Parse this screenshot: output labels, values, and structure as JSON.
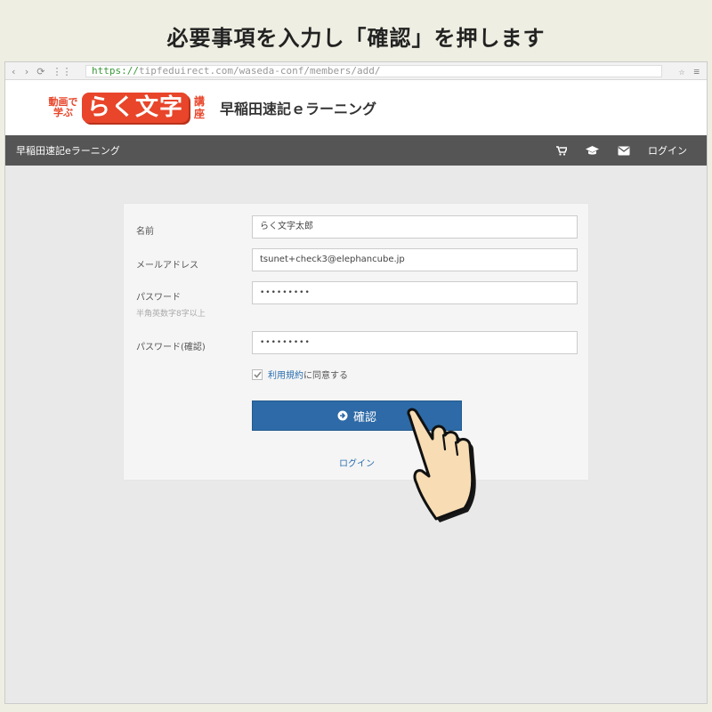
{
  "instruction": "必要事項を入力し「確認」を押します",
  "browser": {
    "url_scheme": "https://",
    "url_rest": "tipfeduirect.com/waseda-conf/members/add/",
    "nav_back": "‹",
    "nav_forward": "›",
    "nav_reload": "⟳",
    "nav_apps": "⋮⋮",
    "star": "☆",
    "menu": "≡"
  },
  "logo": {
    "small_line1": "動画で",
    "small_line2": "学ぶ",
    "big": "らく文字",
    "kou_line1": "講",
    "kou_line2": "座"
  },
  "site_name": "早稲田速記ｅラーニング",
  "navbar": {
    "brand": "早稲田速記eラーニング",
    "login": "ログイン",
    "icons": [
      "cart-icon",
      "graduation-cap-icon",
      "envelope-icon"
    ]
  },
  "form": {
    "name_label": "名前",
    "name_value": "らく文字太郎",
    "email_label": "メールアドレス",
    "email_value": "tsunet+check3@elephancube.jp",
    "password_label": "パスワード",
    "password_hint": "半角英数字8字以上",
    "password_value": "•••••••••",
    "password_confirm_label": "パスワード(確認)",
    "password_confirm_value": "•••••••••",
    "agree_link": "利用規約",
    "agree_text": "に同意する",
    "agree_checked": true,
    "confirm_button": "確認",
    "login_link": "ログイン"
  },
  "colors": {
    "accent_blue": "#2d6aa7",
    "logo_red": "#e8452a",
    "navbar_bg": "#555555"
  }
}
